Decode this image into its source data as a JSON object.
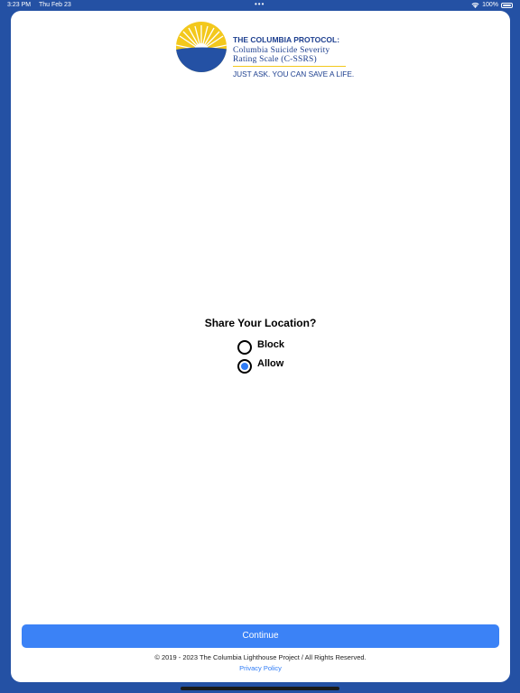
{
  "status_bar": {
    "time": "3:23 PM",
    "date": "Thu Feb 23",
    "dots": "•••",
    "battery": "100%",
    "battery_level": 1.0
  },
  "logo": {
    "title": "THE COLUMBIA PROTOCOL:",
    "line1": "Columbia Suicide Severity",
    "line2": "Rating Scale (C-SSRS)",
    "tagline": "JUST ASK. YOU CAN SAVE A LIFE."
  },
  "question": "Share Your Location?",
  "options": [
    {
      "label": "Block",
      "selected": false
    },
    {
      "label": "Allow",
      "selected": true
    }
  ],
  "continue_label": "Continue",
  "copyright": "© 2019 - 2023 The Columbia Lighthouse Project / All Rights Reserved.",
  "privacy_label": "Privacy Policy",
  "colors": {
    "background": "#2451a4",
    "accent": "#3b82f6",
    "logo_yellow": "#f3c81c",
    "logo_blue": "#1d3f8f"
  }
}
